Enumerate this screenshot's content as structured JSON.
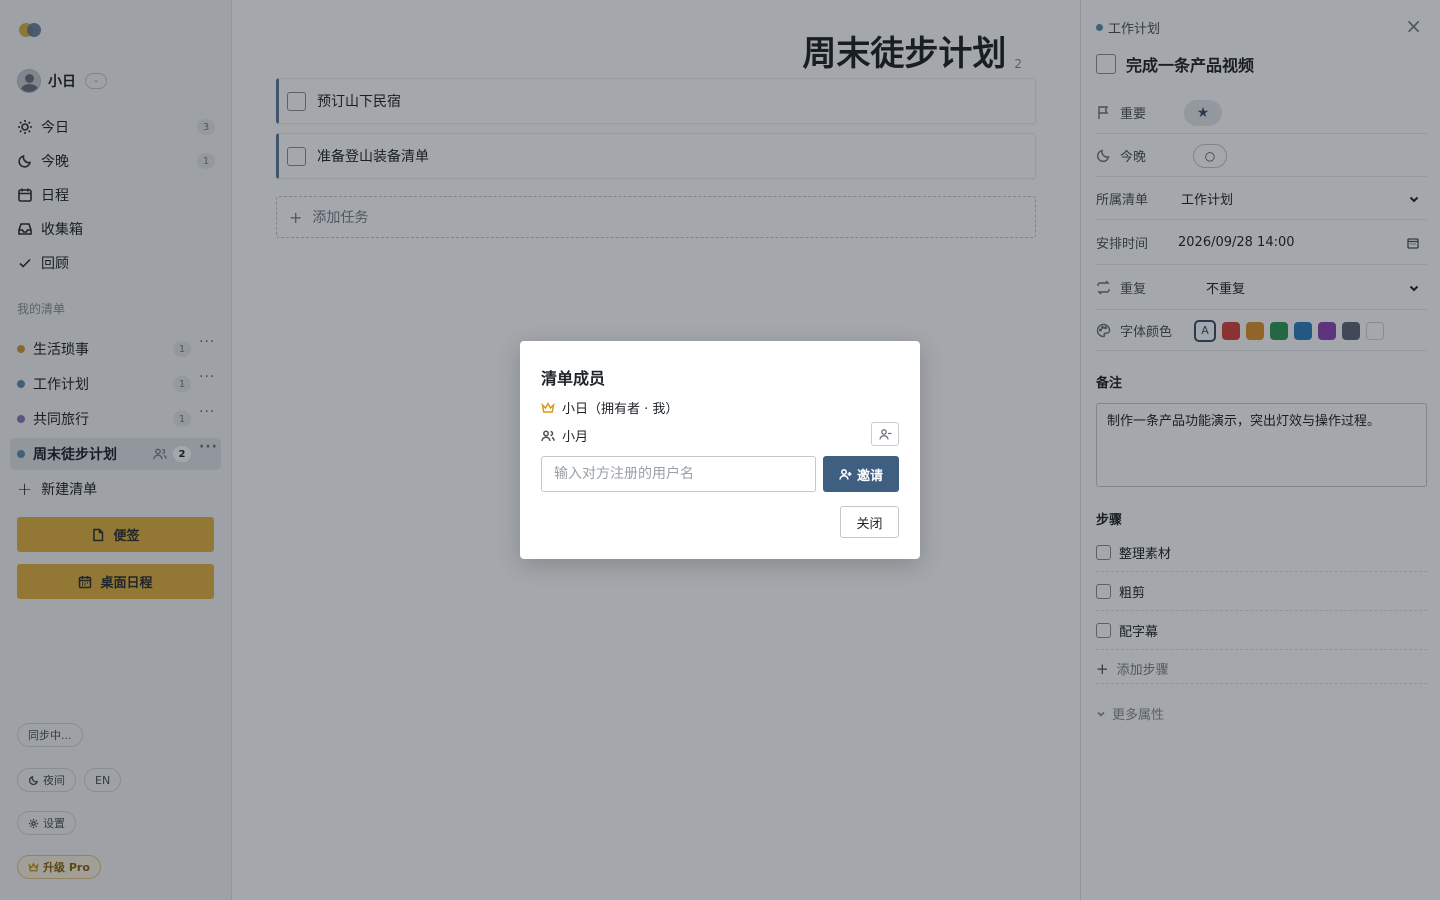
{
  "sidebar": {
    "user": {
      "name": "小日",
      "badge": "-"
    },
    "nav": [
      {
        "icon": "sun-icon",
        "label": "今日",
        "count": "3"
      },
      {
        "icon": "moon-icon",
        "label": "今晚",
        "count": "1"
      },
      {
        "icon": "calendar-icon",
        "label": "日程"
      },
      {
        "icon": "inbox-icon",
        "label": "收集箱"
      },
      {
        "icon": "check-icon",
        "label": "回顾"
      }
    ],
    "section_label": "我的清单",
    "lists": [
      {
        "label": "生活琐事",
        "count": "1",
        "color": "#d59a3c"
      },
      {
        "label": "工作计划",
        "count": "1",
        "color": "#5f8fad"
      },
      {
        "label": "共同旅行",
        "count": "1",
        "color": "#8c7bb8"
      },
      {
        "label": "周末徒步计划",
        "count": "2",
        "color": "#5f8fad",
        "active": true,
        "shared": true
      }
    ],
    "new_list": "新建清单",
    "sticky_btn": "便签",
    "desktop_cal_btn": "桌面日程",
    "sync": "同步中...",
    "night": "夜间",
    "lang": "EN",
    "settings": "设置",
    "upgrade": "升级 Pro"
  },
  "main": {
    "title": "周末徒步计划",
    "count": "2",
    "tasks": [
      {
        "label": "预订山下民宿"
      },
      {
        "label": "准备登山装备清单"
      }
    ],
    "add_task": "添加任务"
  },
  "detail": {
    "list_name": "工作计划",
    "list_color": "#5f8fad",
    "title": "完成一条产品视频",
    "important_label": "重要",
    "important_value": "★",
    "tonight_label": "今晚",
    "tonight_value": "○",
    "list_label": "所属清单",
    "list_value": "工作计划",
    "schedule_label": "安排时间",
    "schedule_value": "2026/09/28 14:00",
    "repeat_label": "重复",
    "repeat_value": "不重复",
    "font_color_label": "字体颜色",
    "font_color_default": "A",
    "font_colors": [
      "#d6453d",
      "#e0952b",
      "#2f9a58",
      "#2f7fc1",
      "#8e46b8",
      "#5e6875"
    ],
    "notes_label": "备注",
    "notes": "制作一条产品功能演示，突出灯效与操作过程。",
    "steps_label": "步骤",
    "steps": [
      {
        "label": "整理素材"
      },
      {
        "label": "粗剪"
      },
      {
        "label": "配字幕"
      }
    ],
    "add_step": "添加步骤",
    "more_props": "更多属性"
  },
  "modal": {
    "title": "清单成员",
    "owner": "小日（拥有者 · 我）",
    "member": "小月",
    "input_placeholder": "输入对方注册的用户名",
    "invite": "邀请",
    "close": "关闭"
  },
  "colors": {
    "accent": "#3f5f81",
    "yellow": "#e3b43f"
  }
}
